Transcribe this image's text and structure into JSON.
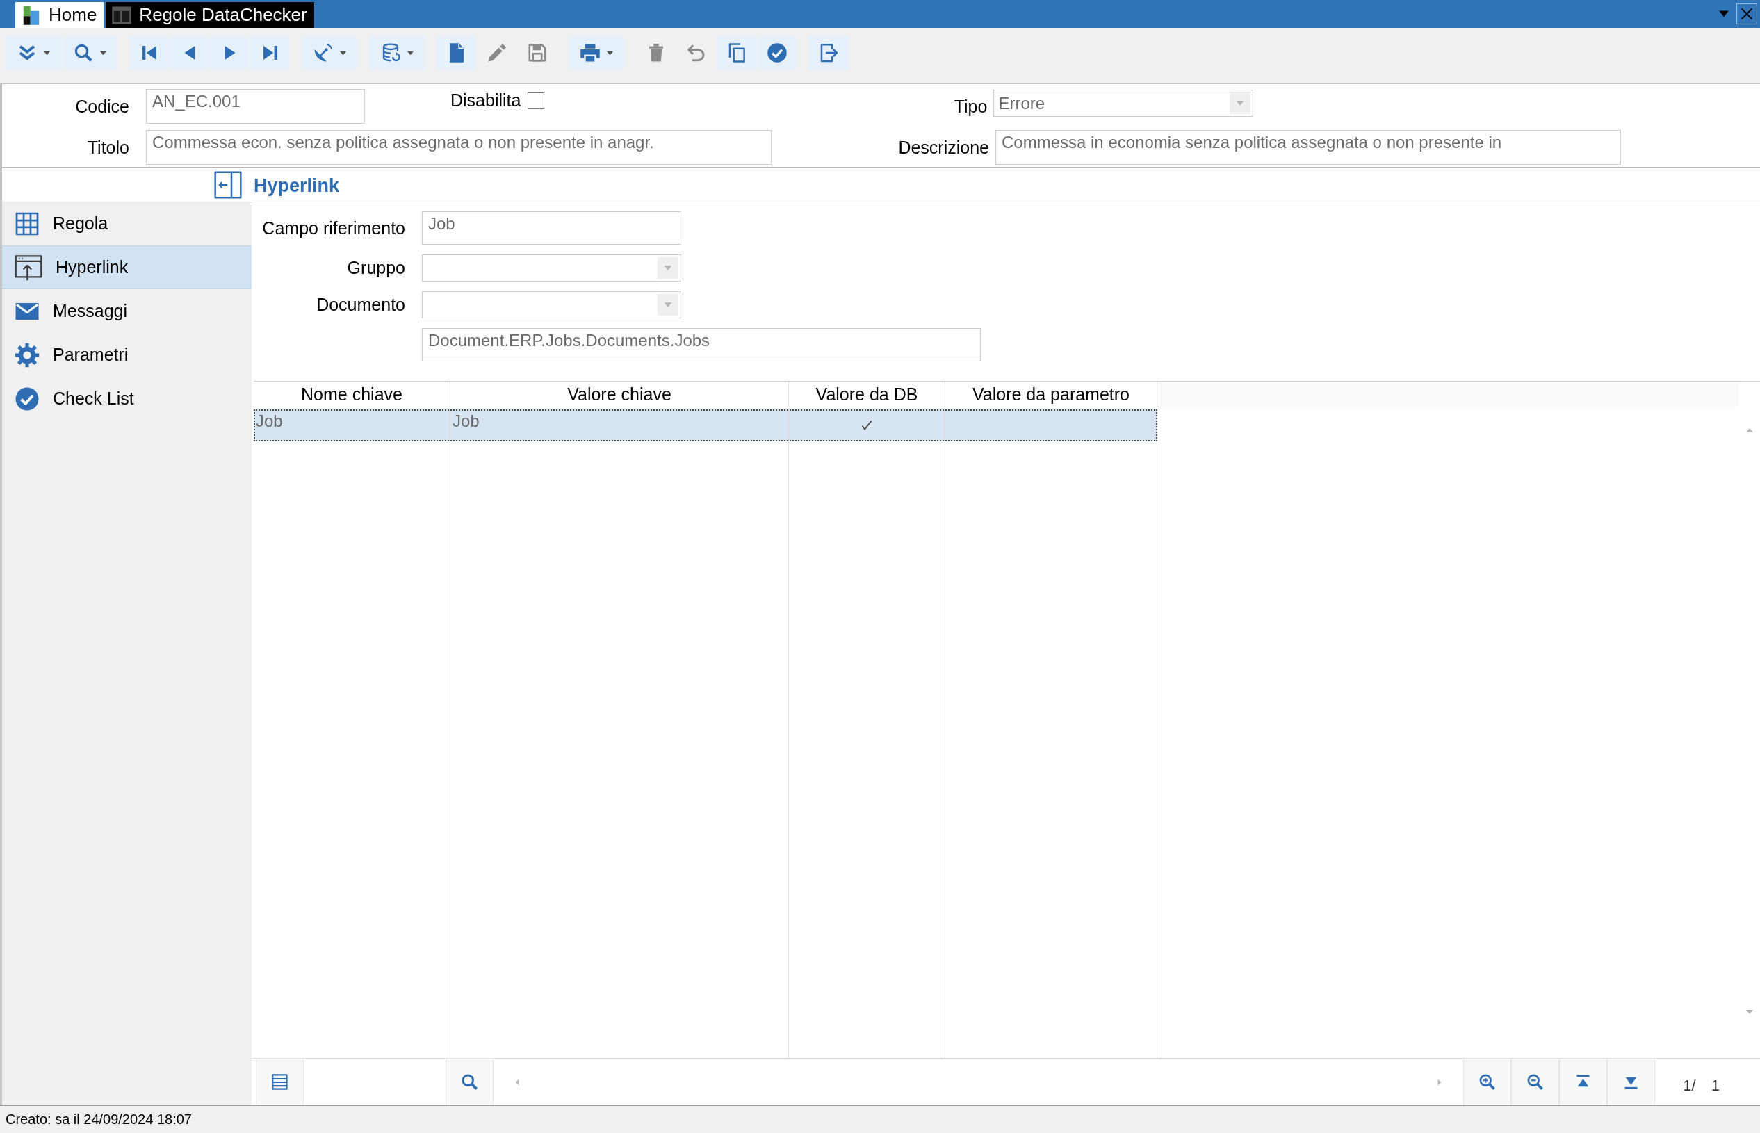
{
  "title_bar": {
    "tabs": [
      {
        "kind": "home",
        "label": "Home",
        "selected": false
      },
      {
        "kind": "form",
        "label": "Regole DataChecker",
        "selected": true
      }
    ],
    "controls": [
      {
        "kind": "menu"
      },
      {
        "kind": "close"
      }
    ]
  },
  "toolbar": {
    "groups": [
      [
        {
          "kind": "expand",
          "menu": true,
          "disabled": false
        },
        {
          "kind": "search",
          "menu": true,
          "disabled": false
        }
      ],
      [
        {
          "kind": "first",
          "menu": false,
          "disabled": false
        },
        {
          "kind": "prev",
          "menu": false,
          "disabled": false
        },
        {
          "kind": "next",
          "menu": false,
          "disabled": false
        },
        {
          "kind": "last",
          "menu": false,
          "disabled": false
        }
      ],
      [
        {
          "kind": "dish",
          "menu": true,
          "disabled": false
        }
      ],
      [
        {
          "kind": "database",
          "menu": true,
          "disabled": false
        }
      ],
      [
        {
          "kind": "new",
          "menu": false,
          "disabled": false
        },
        {
          "kind": "edit",
          "menu": false,
          "disabled": true
        },
        {
          "kind": "save",
          "menu": false,
          "disabled": true
        }
      ],
      [
        {
          "kind": "print",
          "menu": true,
          "disabled": false
        }
      ],
      [
        {
          "kind": "delete",
          "menu": false,
          "disabled": true
        },
        {
          "kind": "undo",
          "menu": false,
          "disabled": true
        },
        {
          "kind": "copy",
          "menu": false,
          "disabled": false
        },
        {
          "kind": "confirm",
          "menu": false,
          "disabled": false
        }
      ],
      [
        {
          "kind": "exit",
          "menu": false,
          "disabled": false
        }
      ]
    ]
  },
  "record": {
    "codice": {
      "label": "Codice",
      "value": "AN_EC.001"
    },
    "disabilita": {
      "label": "Disabilita",
      "checked": false
    },
    "tipo": {
      "label": "Tipo",
      "value": "Errore"
    },
    "titolo": {
      "label": "Titolo",
      "value": "Commessa econ. senza politica assegnata o non presente in anagr."
    },
    "descrizione": {
      "label": "Descrizione",
      "value": "Commessa in economia senza politica assegnata o non presente in"
    }
  },
  "sidebar": {
    "items": [
      {
        "kind": "table",
        "label": "Regola",
        "selected": false
      },
      {
        "kind": "link",
        "label": "Hyperlink",
        "selected": true
      },
      {
        "kind": "mail",
        "label": "Messaggi",
        "selected": false
      },
      {
        "kind": "gear",
        "label": "Parametri",
        "selected": false
      },
      {
        "kind": "check",
        "label": "Check List",
        "selected": false
      }
    ]
  },
  "section": {
    "title": "Hyperlink"
  },
  "hyperlink": {
    "fields": [
      {
        "kind": "text",
        "label": "Campo riferimento",
        "value": "Job"
      },
      {
        "kind": "select",
        "label": "Gruppo"
      },
      {
        "kind": "select",
        "label": "Documento"
      },
      {
        "kind": "text",
        "value": "Document.ERP.Jobs.Documents.Jobs"
      }
    ]
  },
  "grid": {
    "columns": [
      "Nome chiave",
      "Valore chiave",
      "Valore da DB",
      "Valore da parametro"
    ],
    "rows": [
      {
        "nome_chiave": "Job",
        "valore_chiave": "Job",
        "valore_da_db": true,
        "selected": true
      }
    ]
  },
  "grid_nav": {
    "buttons_left": [
      {
        "kind": "list"
      },
      {
        "kind": "search"
      }
    ],
    "buttons_right": [
      {
        "kind": "zoom_in"
      },
      {
        "kind": "zoom_out"
      },
      {
        "kind": "top"
      },
      {
        "kind": "bottom"
      }
    ],
    "pager": "1/ 1"
  },
  "status_bar": {
    "text": "Creato: sa il 24/09/2024 18:07"
  }
}
